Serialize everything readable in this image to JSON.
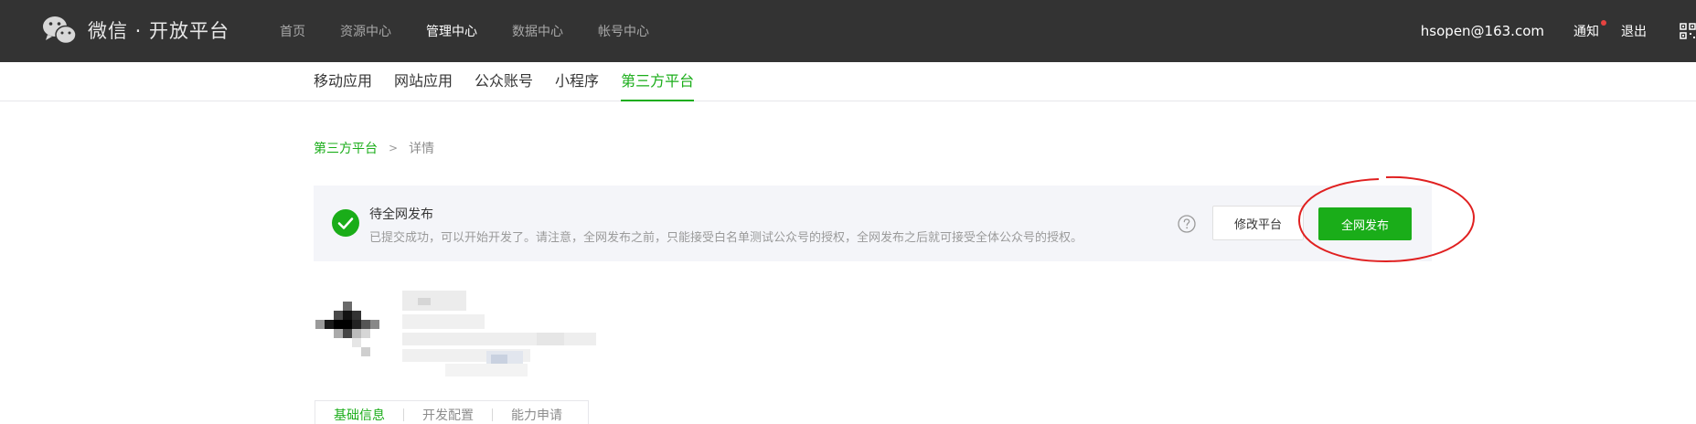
{
  "header": {
    "logo_text": "微信 · 开放平台",
    "nav": [
      {
        "label": "首页",
        "active": false
      },
      {
        "label": "资源中心",
        "active": false
      },
      {
        "label": "管理中心",
        "active": true
      },
      {
        "label": "数据中心",
        "active": false
      },
      {
        "label": "帐号中心",
        "active": false
      }
    ],
    "user_email": "hsopen@163.com",
    "notice_label": "通知",
    "logout_label": "退出"
  },
  "subnav": {
    "items": [
      {
        "label": "移动应用",
        "active": false
      },
      {
        "label": "网站应用",
        "active": false
      },
      {
        "label": "公众账号",
        "active": false
      },
      {
        "label": "小程序",
        "active": false
      },
      {
        "label": "第三方平台",
        "active": true
      }
    ]
  },
  "breadcrumb": {
    "parent": "第三方平台",
    "separator": ">",
    "current": "详情"
  },
  "status": {
    "title": "待全网发布",
    "description": "已提交成功，可以开始开发了。请注意，全网发布之前，只能接受白名单测试公众号的授权，全网发布之后就可接受全体公众号的授权。",
    "edit_button": "修改平台",
    "publish_button": "全网发布"
  },
  "tabs": [
    {
      "label": "基础信息",
      "active": true
    },
    {
      "label": "开发配置",
      "active": false
    },
    {
      "label": "能力申请",
      "active": false
    }
  ],
  "colors": {
    "topbar": "#333333",
    "accent": "#1aad19",
    "annotation": "#e02020"
  },
  "icons": {
    "logo": "wechat-logo-icon",
    "status": "check-circle-icon",
    "help": "question-circle-icon",
    "qr": "qr-code-icon"
  }
}
